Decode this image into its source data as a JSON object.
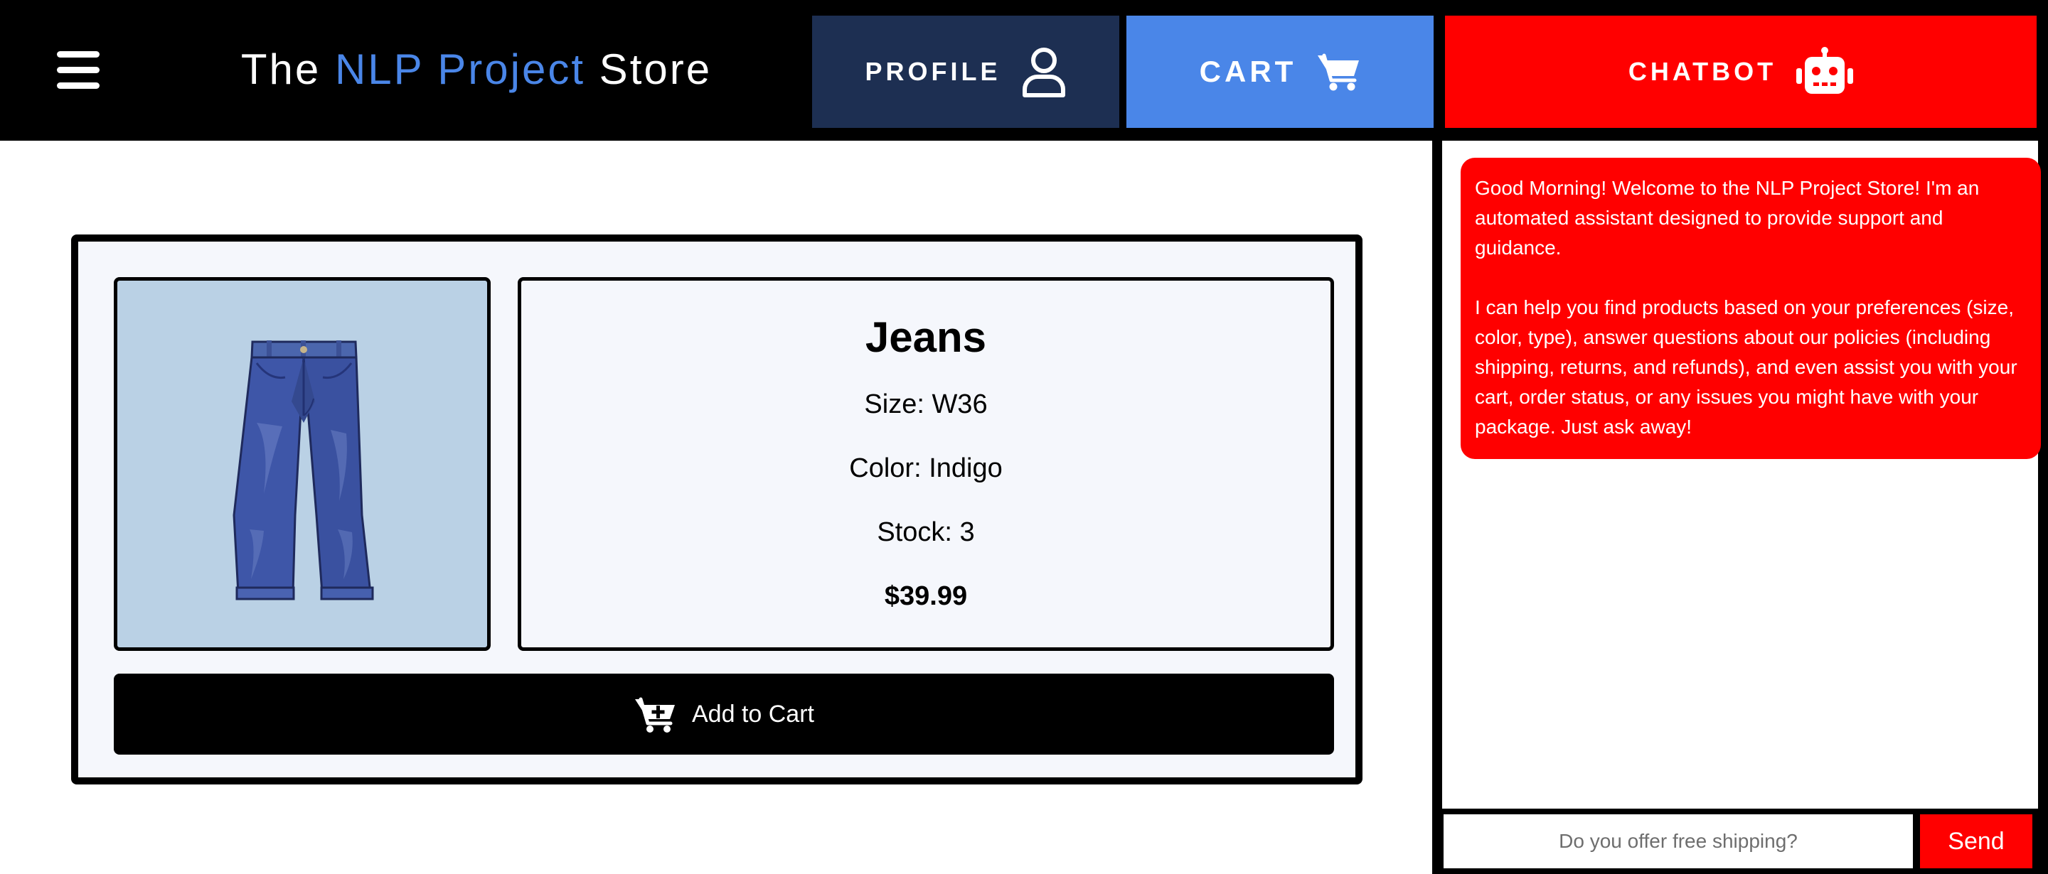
{
  "header": {
    "title_prefix": "The ",
    "title_accent": "NLP Project",
    "title_suffix": " Store",
    "menu_icon": "hamburger-menu-icon",
    "accent_color": "#4a86e8"
  },
  "nav": {
    "profile": {
      "label": "PROFILE",
      "icon": "user-icon",
      "color": "#1d2f52"
    },
    "cart": {
      "label": "CART",
      "icon": "shopping-cart-icon",
      "color": "#4a86e8"
    },
    "chatbot": {
      "label": "CHATBOT",
      "icon": "robot-icon",
      "color": "#ff0000"
    }
  },
  "product": {
    "name": "Jeans",
    "size": "Size: W36",
    "color": "Color: Indigo",
    "stock": "Stock: 3",
    "price": "$39.99",
    "image": "jeans-image",
    "add_to_cart_label": "Add to Cart",
    "add_to_cart_icon": "cart-plus-icon"
  },
  "chat": {
    "messages": [
      {
        "from": "bot",
        "paragraphs": [
          "Good Morning! Welcome to the NLP Project Store! I'm an automated assistant designed to provide support and guidance.",
          "I can help you find products based on your preferences (size, color, type), answer questions about our policies (including shipping, returns, and refunds), and even assist you with your cart, order status, or any issues you might have with your package. Just ask away!"
        ]
      }
    ],
    "input_placeholder": "Do you offer free shipping?",
    "send_label": "Send"
  }
}
